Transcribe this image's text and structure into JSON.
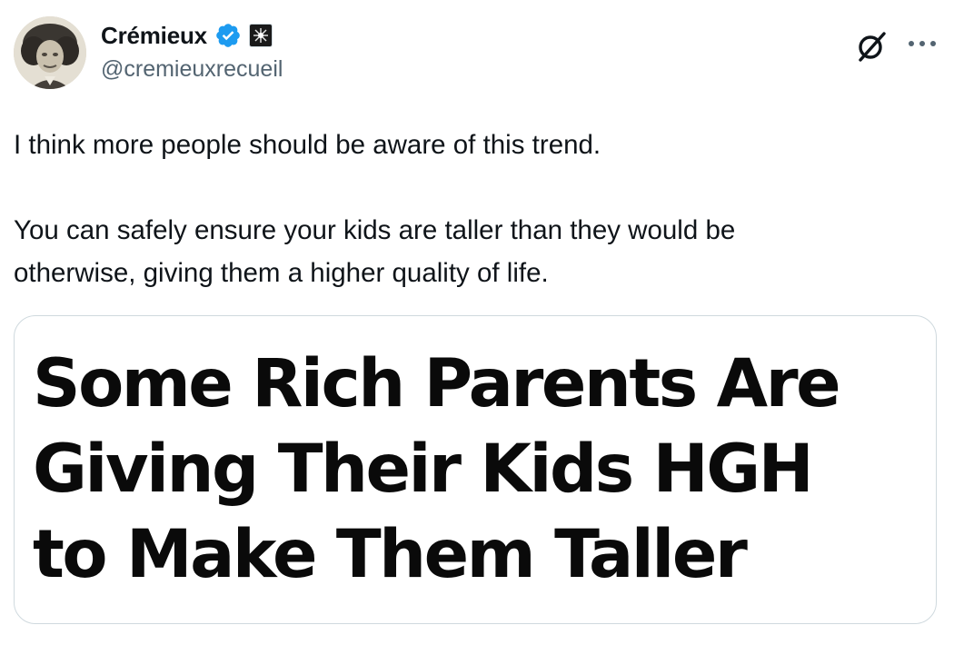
{
  "author": {
    "display_name": "Crémieux",
    "handle": "@cremieuxrecueil",
    "verified_color": "#1d9bf0"
  },
  "icons": {
    "verified": "verified-badge-icon",
    "affiliate": "affiliate-badge-icon",
    "grok": "grok-icon",
    "more": "more-options-icon"
  },
  "tweet": {
    "line1": "I think more people should be aware of this trend.",
    "paragraph2_line1": "You can safely ensure your kids are taller than they would be",
    "paragraph2_line2": "otherwise, giving them a higher quality of life."
  },
  "media": {
    "headline_lines": [
      "Some Rich Parents Are",
      "Giving Their Kids HGH",
      "to Make Them Taller"
    ]
  },
  "colors": {
    "text_primary": "#0f1419",
    "text_secondary": "#536471",
    "border": "#cfd9de",
    "accent": "#1d9bf0"
  }
}
